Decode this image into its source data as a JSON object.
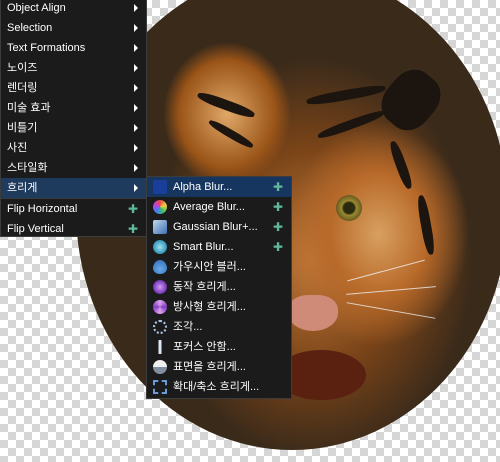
{
  "menu_main": {
    "items": [
      {
        "label": "Object Align",
        "submenu": true
      },
      {
        "label": "Selection",
        "submenu": true
      },
      {
        "label": "Text Formations",
        "submenu": true
      },
      {
        "label": "노이즈",
        "submenu": true
      },
      {
        "label": "렌더링",
        "submenu": true
      },
      {
        "label": "미술 효과",
        "submenu": true
      },
      {
        "label": "비틀기",
        "submenu": true
      },
      {
        "label": "사진",
        "submenu": true
      },
      {
        "label": "스타일화",
        "submenu": true
      },
      {
        "label": "흐리게",
        "submenu": true,
        "active": true
      },
      {
        "label": "Flip Horizontal",
        "plugin": true
      },
      {
        "label": "Flip Vertical",
        "plugin": true
      }
    ]
  },
  "menu_blur": {
    "items": [
      {
        "label": "Alpha Blur...",
        "plugin": true,
        "icon": "alpha-blur-icon"
      },
      {
        "label": "Average Blur...",
        "plugin": true,
        "icon": "average-blur-icon"
      },
      {
        "label": "Gaussian Blur+...",
        "plugin": true,
        "icon": "gaussian-blur-plus-icon"
      },
      {
        "label": "Smart Blur...",
        "plugin": true,
        "icon": "smart-blur-icon"
      },
      {
        "label": "가우시안 블러...",
        "icon": "gaussian-blur-icon"
      },
      {
        "label": "동작 흐리게...",
        "icon": "motion-blur-icon"
      },
      {
        "label": "방사형 흐리게...",
        "icon": "radial-blur-icon"
      },
      {
        "label": "조각...",
        "icon": "fragment-icon"
      },
      {
        "label": "포커스 안함...",
        "icon": "unfocus-icon"
      },
      {
        "label": "표면을 흐리게...",
        "icon": "surface-blur-icon"
      },
      {
        "label": "확대/축소 흐리게...",
        "icon": "zoom-blur-icon"
      }
    ]
  },
  "colors": {
    "menu_bg": "#1b1b1b",
    "active_bg": "#1e3a5c",
    "plugin_icon": "#5fb89a"
  }
}
